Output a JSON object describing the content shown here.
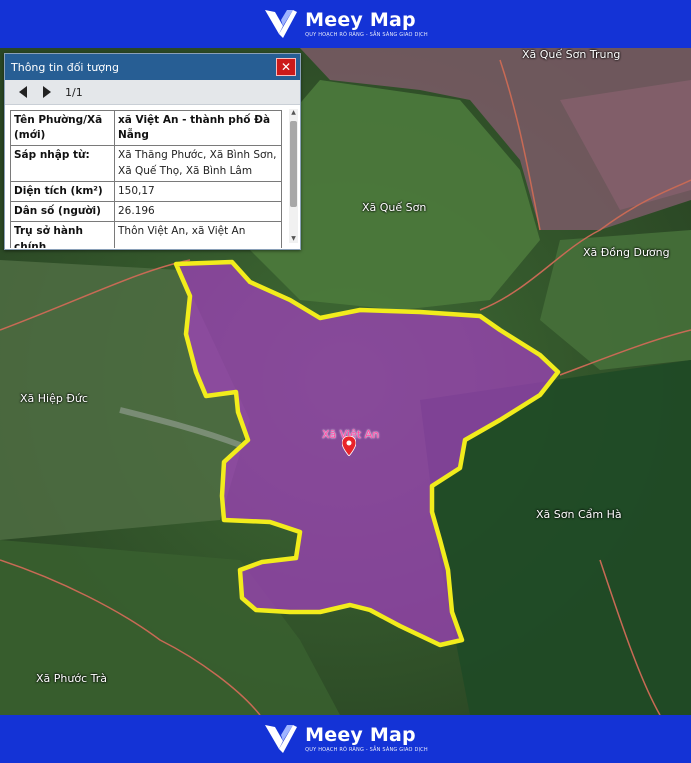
{
  "brand": {
    "name": "Meey Map",
    "tagline": "QUY HOẠCH RÕ RÀNG - SẴN SÀNG GIAO DỊCH"
  },
  "map": {
    "selected_label": "Xã Việt An",
    "labels": {
      "que_son_trung": "Xã Quế Sơn Trung",
      "que_son": "Xã Quế Sơn",
      "dong_duong": "Xã Đồng Dương",
      "hiep_duc": "Xã Hiệp Đức",
      "son_cam_ha": "Xã Sơn Cẩm Hà",
      "phuoc_tra": "Xã Phước Trà"
    },
    "colors": {
      "boundary": "#f2ec1c",
      "fill": "#a43ec0",
      "pin": "#e8232a"
    }
  },
  "panel": {
    "title": "Thông tin đối tượng",
    "close_icon": "✕",
    "page_indicator": "1/1",
    "rows": [
      {
        "key": "Tên Phường/Xã (mới)",
        "value": "xã Việt An - thành phố Đà Nẵng"
      },
      {
        "key": "Sáp nhập từ:",
        "value": "Xã Thăng Phước, Xã Bình Sơn, Xã Quế Thọ, Xã Bình Lâm"
      },
      {
        "key": "Diện tích (km²)",
        "value": "150,17"
      },
      {
        "key": "Dân số (người)",
        "value": "26.196"
      },
      {
        "key": "Trụ sở hành chính",
        "value": "Thôn Việt An, xã Việt An"
      }
    ]
  }
}
